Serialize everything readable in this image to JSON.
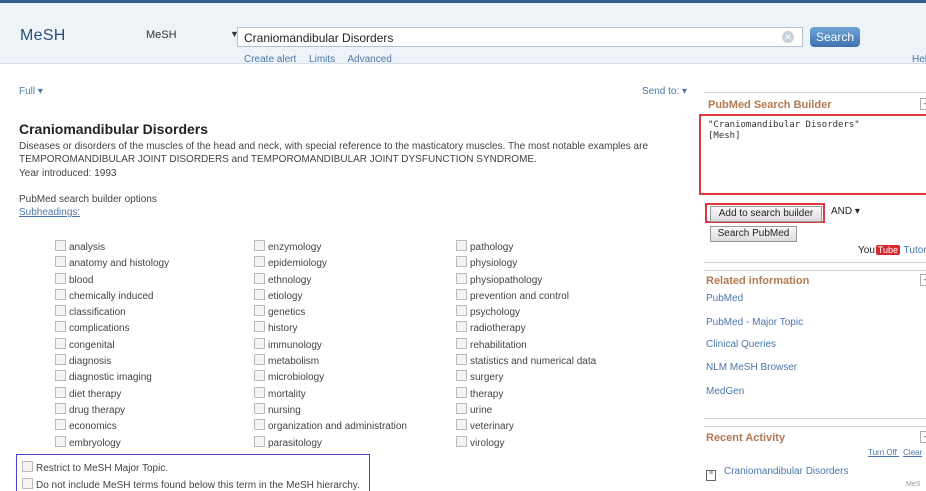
{
  "header": {
    "logo": "MeSH",
    "db_select": "MeSH",
    "query": "Craniomandibular Disorders",
    "search_button": "Search",
    "links": [
      "Create alert",
      "Limits",
      "Advanced"
    ],
    "help": "Hel"
  },
  "toolbar": {
    "format": "Full ▾",
    "send_to": "Send to: ▾"
  },
  "record": {
    "title": "Craniomandibular Disorders",
    "description": "Diseases or disorders of the muscles of the head and neck, with special reference to the masticatory muscles. The most notable examples are TEMPOROMANDIBULAR JOINT DISORDERS and TEMPOROMANDIBULAR JOINT DYSFUNCTION SYNDROME.",
    "year_introduced": "Year introduced: 1993",
    "builder_options_label": "PubMed search builder options",
    "subheadings_link": "Subheadings:"
  },
  "subheadings": {
    "col1": [
      "analysis",
      "anatomy and histology",
      "blood",
      "chemically induced",
      "classification",
      "complications",
      "congenital",
      "diagnosis",
      "diagnostic imaging",
      "diet therapy",
      "drug therapy",
      "economics",
      "embryology"
    ],
    "col2": [
      "enzymology",
      "epidemiology",
      "ethnology",
      "etiology",
      "genetics",
      "history",
      "immunology",
      "metabolism",
      "microbiology",
      "mortality",
      "nursing",
      "organization and administration",
      "parasitology"
    ],
    "col3": [
      "pathology",
      "physiology",
      "physiopathology",
      "prevention and control",
      "psychology",
      "radiotherapy",
      "rehabilitation",
      "statistics and numerical data",
      "surgery",
      "therapy",
      "urine",
      "veterinary",
      "virology"
    ]
  },
  "options": {
    "restrict_major": "Restrict to MeSH Major Topic.",
    "no_explode": "Do not include MeSH terms found below this term in the MeSH hierarchy."
  },
  "sidebar": {
    "builder_title": "PubMed Search Builder",
    "builder_line1": "\"Craniomandibular Disorders\"",
    "builder_line2": "[Mesh]",
    "add_button": "Add to search builder",
    "operator": "AND ▾",
    "search_pubmed": "Search PubMed",
    "youtube_prefix": "You",
    "youtube_tube": "Tube",
    "tutorials": "Tutori",
    "related_title": "Related information",
    "related_links": [
      "PubMed",
      "PubMed - Major Topic",
      "Clinical Queries",
      "NLM MeSH Browser",
      "MedGen"
    ],
    "recent_title": "Recent Activity",
    "turn_off": "Turn Off",
    "clear": "Clear",
    "recent_item": "Craniomandibular Disorders",
    "corner": "MeS"
  }
}
